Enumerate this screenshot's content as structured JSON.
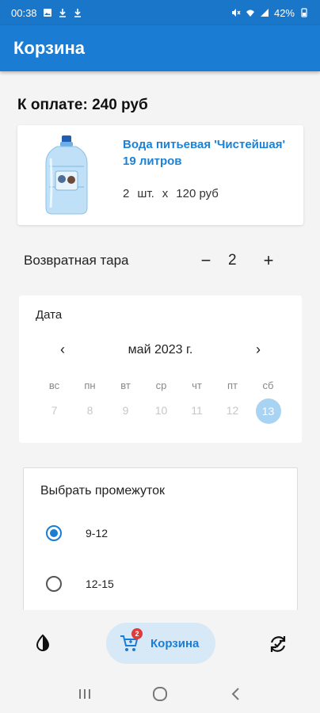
{
  "status_bar": {
    "time": "00:38",
    "battery": "42%"
  },
  "app_bar": {
    "title": "Корзина"
  },
  "cart": {
    "total": "К оплате: 240 руб",
    "product": {
      "name": "Вода питьевая 'Чистейшая' 19 литров",
      "qty": "2",
      "unit": "шт.",
      "times": "x",
      "price": "120 руб"
    },
    "return_tara": {
      "label": "Возвратная тара",
      "minus": "−",
      "value": "2",
      "plus": "+"
    }
  },
  "date_picker": {
    "label": "Дата",
    "month": "май 2023 г.",
    "weekdays": [
      "вс",
      "пн",
      "вт",
      "ср",
      "чт",
      "пт",
      "сб"
    ],
    "days": [
      "7",
      "8",
      "9",
      "10",
      "11",
      "12",
      "13"
    ],
    "selected_day": "13"
  },
  "interval": {
    "title": "Выбрать промежуток",
    "options": [
      {
        "label": "9-12",
        "checked": true
      },
      {
        "label": "12-15",
        "checked": false
      }
    ]
  },
  "bottom_nav": {
    "cart_label": "Корзина",
    "cart_badge": "2"
  },
  "colors": {
    "primary": "#1b7cd3",
    "accent_light": "#d7e9f6",
    "selected_day": "#a9d3f3",
    "badge": "#e03a3a"
  }
}
